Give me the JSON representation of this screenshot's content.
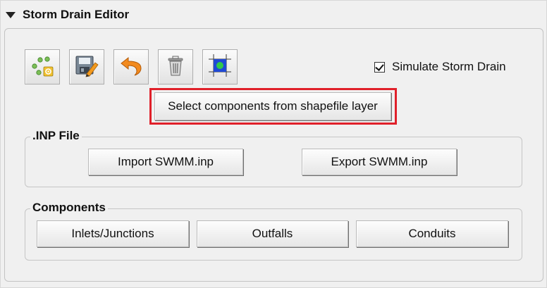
{
  "panel": {
    "title": "Storm Drain Editor"
  },
  "toolbar": {
    "buttons": [
      {
        "icon": "nodes-gear-icon"
      },
      {
        "icon": "save-edit-icon"
      },
      {
        "icon": "undo-arrow-icon"
      },
      {
        "icon": "trash-icon"
      },
      {
        "icon": "select-extent-icon"
      }
    ]
  },
  "simulate": {
    "label": "Simulate Storm Drain",
    "checked": true
  },
  "select_shapefile": {
    "label": "Select components from shapefile layer",
    "highlight_color": "#e0202a"
  },
  "inp_file": {
    "title": ".INP File",
    "import_label": "Import SWMM.inp",
    "export_label": "Export SWMM.inp"
  },
  "components": {
    "title": "Components",
    "inlets_label": "Inlets/Junctions",
    "outfalls_label": "Outfalls",
    "conduits_label": "Conduits"
  }
}
